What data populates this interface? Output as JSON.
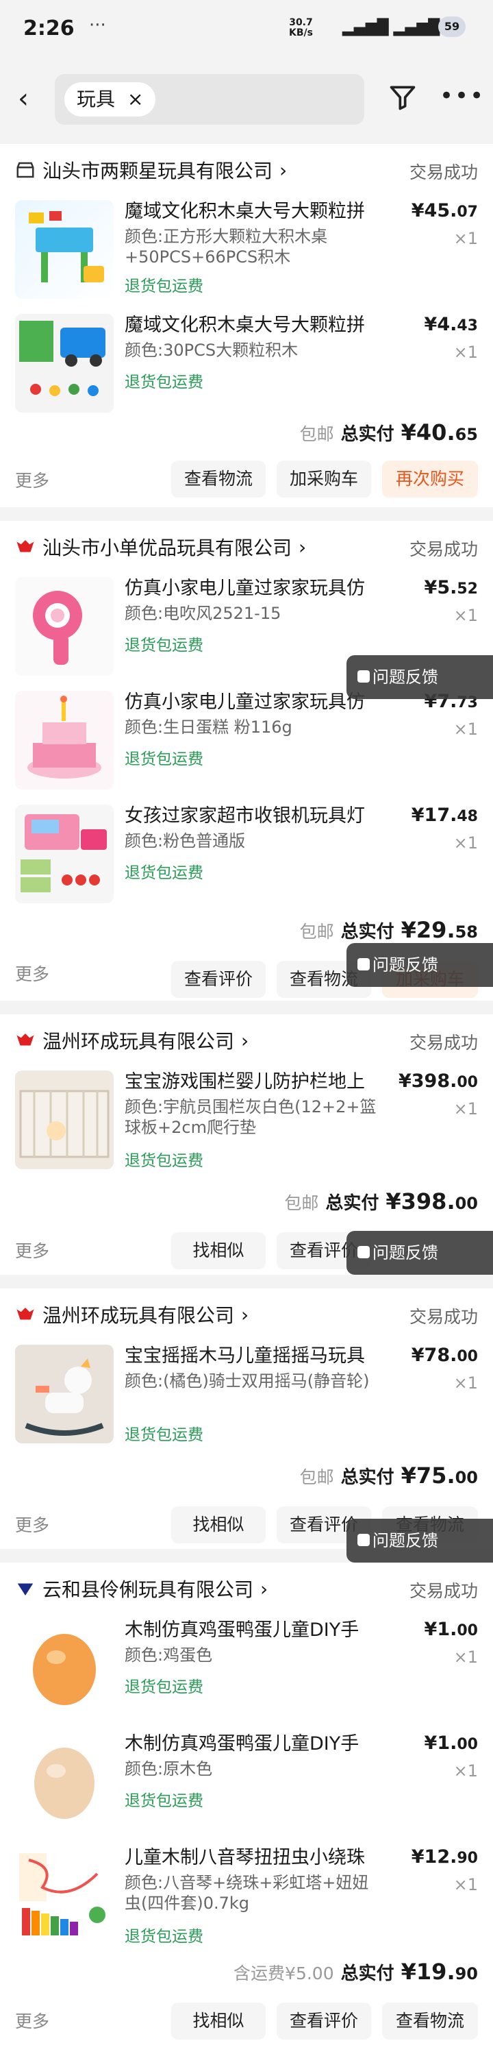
{
  "status_bar": {
    "time": "2:26",
    "dots": "···",
    "speed": "30.7",
    "speed_unit": "KB/s",
    "battery": "59"
  },
  "search": {
    "keyword": "玩具",
    "clear": "×"
  },
  "orders": [
    {
      "shop": "汕头市两颗星玩具有限公司",
      "status": "交易成功",
      "items": [
        {
          "title": "魔域文化积木桌大号大颗粒拼",
          "spec": "颜色:正方形大颗粒大积木桌+50PCS+66PCS积木",
          "policy": "退货包运费",
          "price_int": "¥45.",
          "price_dec": "07",
          "qty": "×1"
        },
        {
          "title": "魔域文化积木桌大号大颗粒拼",
          "spec": "颜色:30PCS大颗粒积木",
          "policy": "退货包运费",
          "price_int": "¥4.",
          "price_dec": "43",
          "qty": "×1"
        }
      ],
      "total": {
        "prefix": "包邮",
        "label": "总实付",
        "int": "¥40.",
        "dec": "65"
      },
      "more": "更多",
      "buttons": [
        "查看物流",
        "加采购车",
        "再次购买"
      ]
    },
    {
      "shop": "汕头市小单优品玩具有限公司",
      "status": "交易成功",
      "items": [
        {
          "title": "仿真小家电儿童过家家玩具仿",
          "spec": "颜色:电吹风2521-15",
          "policy": "退货包运费",
          "price_int": "¥5.",
          "price_dec": "52",
          "qty": "×1"
        },
        {
          "title": "仿真小家电儿童过家家玩具仿",
          "spec": "颜色:生日蛋糕 粉116g",
          "policy": "退货包运费",
          "price_int": "¥7.",
          "price_dec": "73",
          "qty": "×1"
        },
        {
          "title": "女孩过家家超市收银机玩具灯",
          "spec": "颜色:粉色普通版",
          "policy": "退货包运费",
          "price_int": "¥17.",
          "price_dec": "48",
          "qty": "×1"
        }
      ],
      "total": {
        "prefix": "包邮",
        "label": "总实付",
        "int": "¥29.",
        "dec": "58"
      },
      "more": "更多",
      "buttons": [
        "查看评价",
        "查看物流",
        "加采购车"
      ]
    },
    {
      "shop": "温州环成玩具有限公司",
      "status": "交易成功",
      "items": [
        {
          "title": "宝宝游戏围栏婴儿防护栏地上",
          "spec": "颜色:宇航员围栏灰白色(12+2+篮球板+2cm爬行垫",
          "policy": "退货包运费",
          "price_int": "¥398.",
          "price_dec": "00",
          "qty": "×1"
        }
      ],
      "total": {
        "prefix": "包邮",
        "label": "总实付",
        "int": "¥398.",
        "dec": "00"
      },
      "more": "更多",
      "buttons": [
        "找相似",
        "查看评价"
      ]
    },
    {
      "shop": "温州环成玩具有限公司",
      "status": "交易成功",
      "items": [
        {
          "title": "宝宝摇摇木马儿童摇摇马玩具",
          "spec": "颜色:(橘色)骑士双用摇马(静音轮)",
          "policy": "退货包运费",
          "price_int": "¥78.",
          "price_dec": "00",
          "qty": "×1"
        }
      ],
      "total": {
        "prefix": "包邮",
        "label": "总实付",
        "int": "¥75.",
        "dec": "00"
      },
      "more": "更多",
      "buttons": [
        "找相似",
        "查看评价",
        "查看物流"
      ]
    },
    {
      "shop": "云和县伶俐玩具有限公司",
      "status": "交易成功",
      "items": [
        {
          "title": "木制仿真鸡蛋鸭蛋儿童DIY手",
          "spec": "颜色:鸡蛋色",
          "policy": "退货包运费",
          "price_int": "¥1.",
          "price_dec": "00",
          "qty": "×1"
        },
        {
          "title": "木制仿真鸡蛋鸭蛋儿童DIY手",
          "spec": "颜色:原木色",
          "policy": "退货包运费",
          "price_int": "¥1.",
          "price_dec": "00",
          "qty": "×1"
        },
        {
          "title": "儿童木制八音琴扭扭虫小绕珠",
          "spec": "颜色:八音琴+绕珠+彩虹塔+妞妞虫(四件套)0.7kg",
          "policy": "退货包运费",
          "price_int": "¥12.",
          "price_dec": "90",
          "qty": "×1"
        }
      ],
      "total": {
        "prefix": "含运费¥5.00",
        "label": "总实付",
        "int": "¥19.",
        "dec": "90"
      },
      "more": "更多",
      "buttons": [
        "找相似",
        "查看评价",
        "查看物流"
      ]
    }
  ],
  "feedback_label": "问题反馈",
  "colors": {
    "accent": "#e8561e",
    "green": "#2a9d57",
    "shop_red": "#e02020",
    "shop_blue": "#1a2a8a"
  }
}
